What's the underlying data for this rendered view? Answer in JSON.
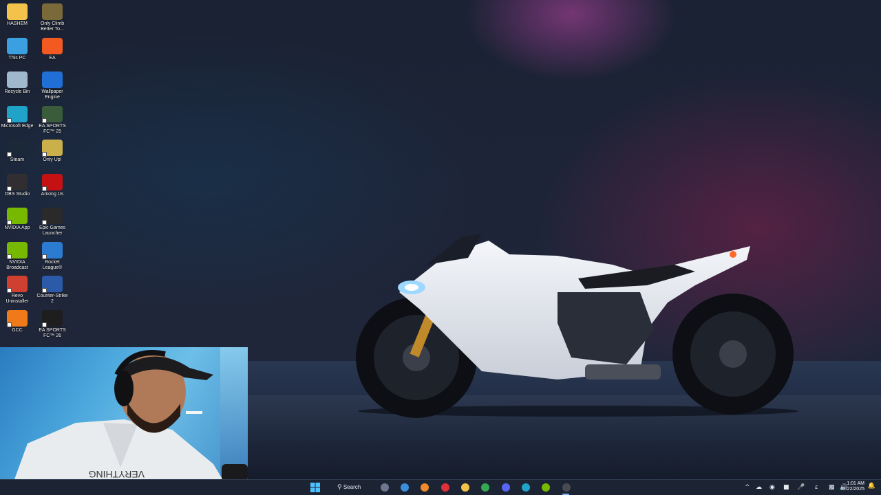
{
  "desktop": {
    "icons": [
      {
        "label": "HASHEM",
        "icon": "folder-icon",
        "color": "#f2c24a"
      },
      {
        "label": "Only Climb Better To...",
        "icon": "game-only-climb-icon",
        "color": "#7a6a3a"
      },
      {
        "label": "This PC",
        "icon": "monitor-icon",
        "color": "#3aa0e0"
      },
      {
        "label": "EA",
        "icon": "ea-icon",
        "color": "#f25a22"
      },
      {
        "label": "Recycle Bin",
        "icon": "recycle-bin-icon",
        "color": "#9fb8cc"
      },
      {
        "label": "Wallpaper Engine",
        "icon": "wallpaper-engine-icon",
        "color": "#1f6fd6"
      },
      {
        "label": "Microsoft Edge",
        "icon": "edge-icon",
        "color": "#1fa3c9"
      },
      {
        "label": "EA SPORTS FC™ 25",
        "icon": "ea-fc25-icon",
        "color": "#3a5c3a"
      },
      {
        "label": "Steam",
        "icon": "steam-icon",
        "color": "#1b2838"
      },
      {
        "label": "Only Up!",
        "icon": "only-up-icon",
        "color": "#c9b04a"
      },
      {
        "label": "OBS Studio",
        "icon": "obs-icon",
        "color": "#302e31"
      },
      {
        "label": "Among Us",
        "icon": "among-us-icon",
        "color": "#c51111"
      },
      {
        "label": "NVIDIA App",
        "icon": "nvidia-icon",
        "color": "#76b900"
      },
      {
        "label": "Epic Games Launcher",
        "icon": "epic-games-icon",
        "color": "#2a2a2a"
      },
      {
        "label": "NVIDIA Broadcast",
        "icon": "nvidia-broadcast-icon",
        "color": "#76b900"
      },
      {
        "label": "Rocket League®",
        "icon": "rocket-league-icon",
        "color": "#2b7bd1"
      },
      {
        "label": "Revo Uninstaller",
        "icon": "revo-uninstaller-icon",
        "color": "#d04030"
      },
      {
        "label": "Counter-Strike 2",
        "icon": "counter-strike-icon",
        "color": "#2b5aa8"
      },
      {
        "label": "GCC",
        "icon": "gcc-icon",
        "color": "#f07a1a"
      },
      {
        "label": "EA SPORTS FC™ 26",
        "icon": "ea-fc26-icon",
        "color": "#1e1e1e"
      }
    ]
  },
  "taskbar": {
    "search_label": "Search",
    "apps": [
      {
        "icon": "settings-gear-icon",
        "color": "#6b7890"
      },
      {
        "icon": "photos-icon",
        "color": "#3a8ee0"
      },
      {
        "icon": "cloud-app-icon",
        "color": "#f08a2a"
      },
      {
        "icon": "red-circle-app-icon",
        "color": "#e0303a"
      },
      {
        "icon": "file-explorer-icon",
        "color": "#f2c24a"
      },
      {
        "icon": "chrome-icon",
        "color": "#34a853"
      },
      {
        "icon": "discord-icon",
        "color": "#5865f2"
      },
      {
        "icon": "edge-taskbar-icon",
        "color": "#1fa3c9"
      },
      {
        "icon": "nvidia-taskbar-icon",
        "color": "#76b900"
      },
      {
        "icon": "obs-taskbar-icon",
        "color": "#4a4a52"
      }
    ],
    "tray": {
      "chevron": "^",
      "language": "£",
      "time": "1:01 AM",
      "date": "12/22/2025"
    }
  }
}
